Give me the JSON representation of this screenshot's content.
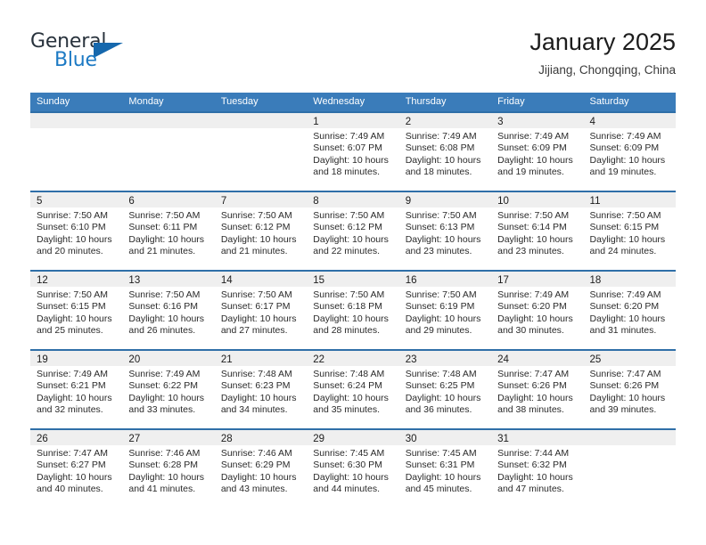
{
  "brand": {
    "name_top": "General",
    "name_bottom": "Blue",
    "accent_color": "#1d7ac4",
    "flag_color": "#1668ad"
  },
  "header": {
    "title": "January 2025",
    "subtitle": "Jijiang, Chongqing, China"
  },
  "theme": {
    "header_row_bg": "#3a7cba",
    "cell_top_border": "#2f6fa8",
    "day_band_bg": "#efefef"
  },
  "weekdays": [
    "Sunday",
    "Monday",
    "Tuesday",
    "Wednesday",
    "Thursday",
    "Friday",
    "Saturday"
  ],
  "weeks": [
    [
      {
        "day": "",
        "sunrise": "",
        "sunset": "",
        "daylight_line1": "",
        "daylight_line2": ""
      },
      {
        "day": "",
        "sunrise": "",
        "sunset": "",
        "daylight_line1": "",
        "daylight_line2": ""
      },
      {
        "day": "",
        "sunrise": "",
        "sunset": "",
        "daylight_line1": "",
        "daylight_line2": ""
      },
      {
        "day": "1",
        "sunrise": "Sunrise: 7:49 AM",
        "sunset": "Sunset: 6:07 PM",
        "daylight_line1": "Daylight: 10 hours",
        "daylight_line2": "and 18 minutes."
      },
      {
        "day": "2",
        "sunrise": "Sunrise: 7:49 AM",
        "sunset": "Sunset: 6:08 PM",
        "daylight_line1": "Daylight: 10 hours",
        "daylight_line2": "and 18 minutes."
      },
      {
        "day": "3",
        "sunrise": "Sunrise: 7:49 AM",
        "sunset": "Sunset: 6:09 PM",
        "daylight_line1": "Daylight: 10 hours",
        "daylight_line2": "and 19 minutes."
      },
      {
        "day": "4",
        "sunrise": "Sunrise: 7:49 AM",
        "sunset": "Sunset: 6:09 PM",
        "daylight_line1": "Daylight: 10 hours",
        "daylight_line2": "and 19 minutes."
      }
    ],
    [
      {
        "day": "5",
        "sunrise": "Sunrise: 7:50 AM",
        "sunset": "Sunset: 6:10 PM",
        "daylight_line1": "Daylight: 10 hours",
        "daylight_line2": "and 20 minutes."
      },
      {
        "day": "6",
        "sunrise": "Sunrise: 7:50 AM",
        "sunset": "Sunset: 6:11 PM",
        "daylight_line1": "Daylight: 10 hours",
        "daylight_line2": "and 21 minutes."
      },
      {
        "day": "7",
        "sunrise": "Sunrise: 7:50 AM",
        "sunset": "Sunset: 6:12 PM",
        "daylight_line1": "Daylight: 10 hours",
        "daylight_line2": "and 21 minutes."
      },
      {
        "day": "8",
        "sunrise": "Sunrise: 7:50 AM",
        "sunset": "Sunset: 6:12 PM",
        "daylight_line1": "Daylight: 10 hours",
        "daylight_line2": "and 22 minutes."
      },
      {
        "day": "9",
        "sunrise": "Sunrise: 7:50 AM",
        "sunset": "Sunset: 6:13 PM",
        "daylight_line1": "Daylight: 10 hours",
        "daylight_line2": "and 23 minutes."
      },
      {
        "day": "10",
        "sunrise": "Sunrise: 7:50 AM",
        "sunset": "Sunset: 6:14 PM",
        "daylight_line1": "Daylight: 10 hours",
        "daylight_line2": "and 23 minutes."
      },
      {
        "day": "11",
        "sunrise": "Sunrise: 7:50 AM",
        "sunset": "Sunset: 6:15 PM",
        "daylight_line1": "Daylight: 10 hours",
        "daylight_line2": "and 24 minutes."
      }
    ],
    [
      {
        "day": "12",
        "sunrise": "Sunrise: 7:50 AM",
        "sunset": "Sunset: 6:15 PM",
        "daylight_line1": "Daylight: 10 hours",
        "daylight_line2": "and 25 minutes."
      },
      {
        "day": "13",
        "sunrise": "Sunrise: 7:50 AM",
        "sunset": "Sunset: 6:16 PM",
        "daylight_line1": "Daylight: 10 hours",
        "daylight_line2": "and 26 minutes."
      },
      {
        "day": "14",
        "sunrise": "Sunrise: 7:50 AM",
        "sunset": "Sunset: 6:17 PM",
        "daylight_line1": "Daylight: 10 hours",
        "daylight_line2": "and 27 minutes."
      },
      {
        "day": "15",
        "sunrise": "Sunrise: 7:50 AM",
        "sunset": "Sunset: 6:18 PM",
        "daylight_line1": "Daylight: 10 hours",
        "daylight_line2": "and 28 minutes."
      },
      {
        "day": "16",
        "sunrise": "Sunrise: 7:50 AM",
        "sunset": "Sunset: 6:19 PM",
        "daylight_line1": "Daylight: 10 hours",
        "daylight_line2": "and 29 minutes."
      },
      {
        "day": "17",
        "sunrise": "Sunrise: 7:49 AM",
        "sunset": "Sunset: 6:20 PM",
        "daylight_line1": "Daylight: 10 hours",
        "daylight_line2": "and 30 minutes."
      },
      {
        "day": "18",
        "sunrise": "Sunrise: 7:49 AM",
        "sunset": "Sunset: 6:20 PM",
        "daylight_line1": "Daylight: 10 hours",
        "daylight_line2": "and 31 minutes."
      }
    ],
    [
      {
        "day": "19",
        "sunrise": "Sunrise: 7:49 AM",
        "sunset": "Sunset: 6:21 PM",
        "daylight_line1": "Daylight: 10 hours",
        "daylight_line2": "and 32 minutes."
      },
      {
        "day": "20",
        "sunrise": "Sunrise: 7:49 AM",
        "sunset": "Sunset: 6:22 PM",
        "daylight_line1": "Daylight: 10 hours",
        "daylight_line2": "and 33 minutes."
      },
      {
        "day": "21",
        "sunrise": "Sunrise: 7:48 AM",
        "sunset": "Sunset: 6:23 PM",
        "daylight_line1": "Daylight: 10 hours",
        "daylight_line2": "and 34 minutes."
      },
      {
        "day": "22",
        "sunrise": "Sunrise: 7:48 AM",
        "sunset": "Sunset: 6:24 PM",
        "daylight_line1": "Daylight: 10 hours",
        "daylight_line2": "and 35 minutes."
      },
      {
        "day": "23",
        "sunrise": "Sunrise: 7:48 AM",
        "sunset": "Sunset: 6:25 PM",
        "daylight_line1": "Daylight: 10 hours",
        "daylight_line2": "and 36 minutes."
      },
      {
        "day": "24",
        "sunrise": "Sunrise: 7:47 AM",
        "sunset": "Sunset: 6:26 PM",
        "daylight_line1": "Daylight: 10 hours",
        "daylight_line2": "and 38 minutes."
      },
      {
        "day": "25",
        "sunrise": "Sunrise: 7:47 AM",
        "sunset": "Sunset: 6:26 PM",
        "daylight_line1": "Daylight: 10 hours",
        "daylight_line2": "and 39 minutes."
      }
    ],
    [
      {
        "day": "26",
        "sunrise": "Sunrise: 7:47 AM",
        "sunset": "Sunset: 6:27 PM",
        "daylight_line1": "Daylight: 10 hours",
        "daylight_line2": "and 40 minutes."
      },
      {
        "day": "27",
        "sunrise": "Sunrise: 7:46 AM",
        "sunset": "Sunset: 6:28 PM",
        "daylight_line1": "Daylight: 10 hours",
        "daylight_line2": "and 41 minutes."
      },
      {
        "day": "28",
        "sunrise": "Sunrise: 7:46 AM",
        "sunset": "Sunset: 6:29 PM",
        "daylight_line1": "Daylight: 10 hours",
        "daylight_line2": "and 43 minutes."
      },
      {
        "day": "29",
        "sunrise": "Sunrise: 7:45 AM",
        "sunset": "Sunset: 6:30 PM",
        "daylight_line1": "Daylight: 10 hours",
        "daylight_line2": "and 44 minutes."
      },
      {
        "day": "30",
        "sunrise": "Sunrise: 7:45 AM",
        "sunset": "Sunset: 6:31 PM",
        "daylight_line1": "Daylight: 10 hours",
        "daylight_line2": "and 45 minutes."
      },
      {
        "day": "31",
        "sunrise": "Sunrise: 7:44 AM",
        "sunset": "Sunset: 6:32 PM",
        "daylight_line1": "Daylight: 10 hours",
        "daylight_line2": "and 47 minutes."
      },
      {
        "day": "",
        "sunrise": "",
        "sunset": "",
        "daylight_line1": "",
        "daylight_line2": ""
      }
    ]
  ]
}
